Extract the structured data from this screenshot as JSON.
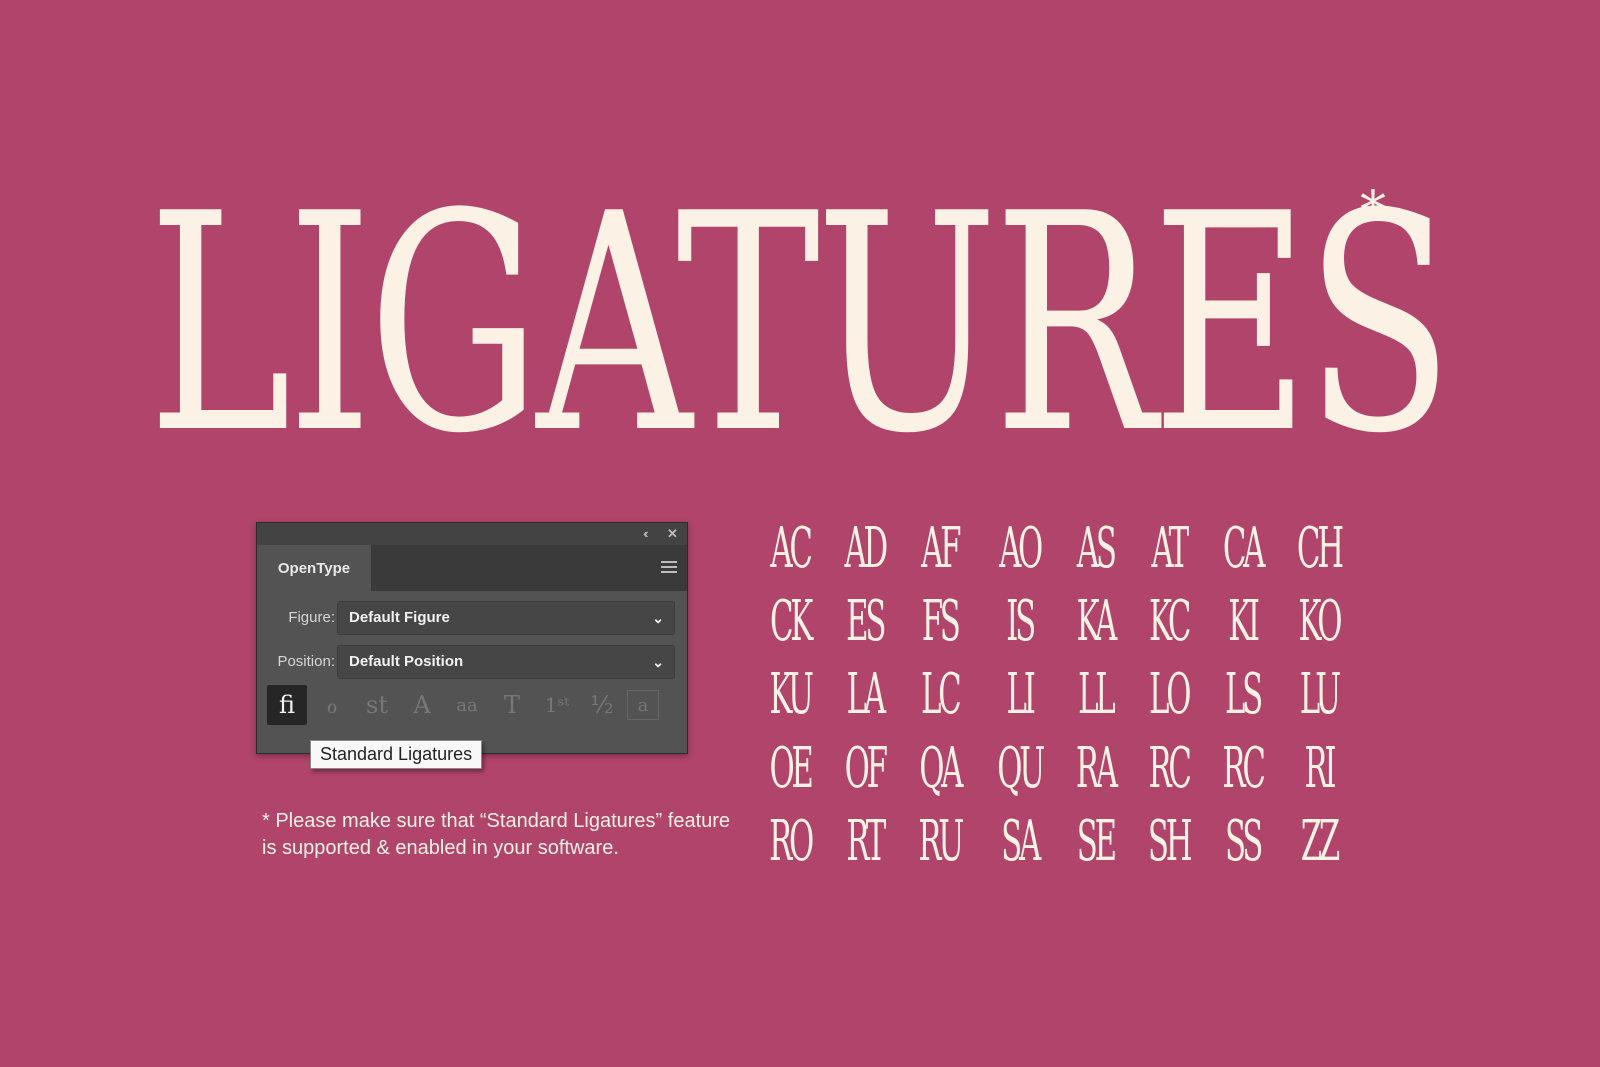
{
  "hero": {
    "title": "LIGATURES",
    "asterisk": "*"
  },
  "panel": {
    "title_controls": {
      "collapse": "‹‹",
      "close": "✕"
    },
    "tab": "OpenType",
    "figure": {
      "label": "Figure:",
      "value": "Default Figure"
    },
    "position": {
      "label": "Position:",
      "value": "Default Position"
    },
    "icons": [
      {
        "name": "standard-ligatures-icon",
        "glyph": "fi",
        "active": true
      },
      {
        "name": "contextual-alternates-icon",
        "glyph": "ℴ"
      },
      {
        "name": "discretionary-ligatures-icon",
        "glyph": "st"
      },
      {
        "name": "swash-icon",
        "glyph": "A"
      },
      {
        "name": "stylistic-alternates-icon",
        "glyph": "aa"
      },
      {
        "name": "titling-alternates-icon",
        "glyph": "T"
      },
      {
        "name": "ordinals-icon",
        "glyph": "1ˢᵗ"
      },
      {
        "name": "fractions-icon",
        "glyph": "½"
      },
      {
        "name": "stylistic-sets-icon",
        "glyph": "a"
      }
    ],
    "tooltip": "Standard Ligatures"
  },
  "footnote": "* Please make sure that “Standard Ligatures” feature is supported & enabled in your software.",
  "ligatures": [
    "AC",
    "AD",
    "AF",
    "AO",
    "AS",
    "AT",
    "CA",
    "CH",
    "CK",
    "ES",
    "FS",
    "IS",
    "KA",
    "KC",
    "KI",
    "KO",
    "KU",
    "LA",
    "LC",
    "LI",
    "LL",
    "LO",
    "LS",
    "LU",
    "OE",
    "OF",
    "QA",
    "QU",
    "RA",
    "RC",
    "RC",
    "RI",
    "RO",
    "RT",
    "RU",
    "SA",
    "SE",
    "SH",
    "SS",
    "ZZ"
  ],
  "colors": {
    "background": "#b1446b",
    "cream": "#fbf1e4",
    "panel": "#535353"
  }
}
